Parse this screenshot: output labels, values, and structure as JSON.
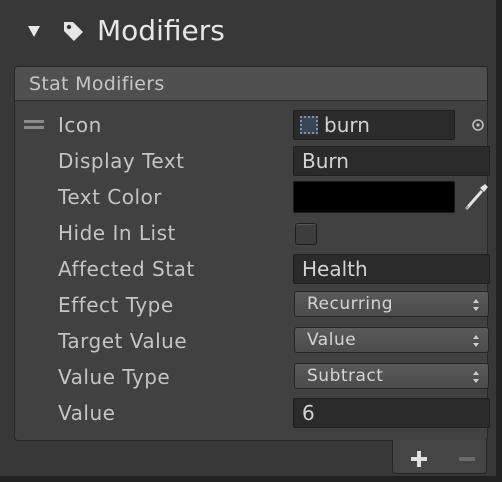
{
  "header": {
    "title": "Modifiers",
    "foldout_icon": "foldout-expanded-arrow",
    "tag_icon": "tag-icon"
  },
  "stat_modifiers": {
    "title": "Stat Modifiers",
    "fields": {
      "icon": {
        "label": "Icon",
        "value": "burn"
      },
      "display_text": {
        "label": "Display Text",
        "value": "Burn"
      },
      "text_color": {
        "label": "Text Color",
        "value": "#000000"
      },
      "hide_in_list": {
        "label": "Hide In List",
        "checked": false
      },
      "affected_stat": {
        "label": "Affected Stat",
        "value": "Health"
      },
      "effect_type": {
        "label": "Effect Type",
        "value": "Recurring"
      },
      "target_value": {
        "label": "Target Value",
        "value": "Value"
      },
      "value_type": {
        "label": "Value Type",
        "value": "Subtract"
      },
      "value": {
        "label": "Value",
        "value": "6"
      }
    }
  },
  "footer": {
    "add_label": "+",
    "remove_label": "−"
  },
  "colors": {
    "background": "#383838",
    "panel": "#414141",
    "field": "#2b2b2b",
    "text": "#c4c4c4"
  }
}
